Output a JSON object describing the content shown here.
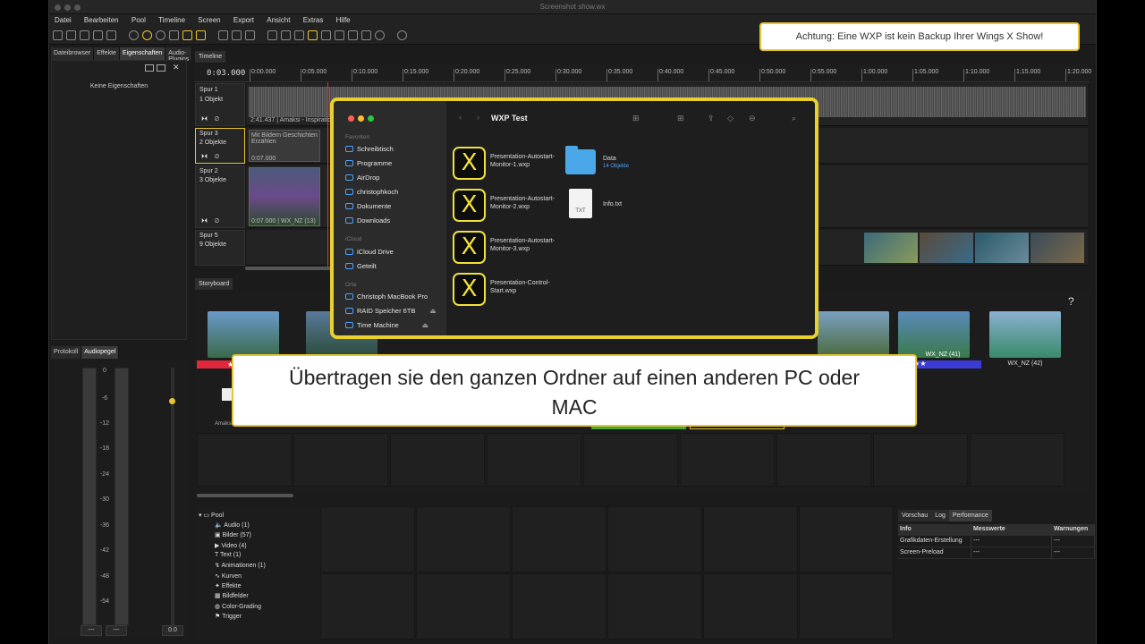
{
  "window": {
    "title": "Screenshot show.wx"
  },
  "menu": [
    "Datei",
    "Bearbeiten",
    "Pool",
    "Timeline",
    "Screen",
    "Export",
    "Ansicht",
    "Extras",
    "Hilfe"
  ],
  "notice": {
    "text": "Achtung: Eine WXP ist kein Backup Ihrer Wings X Show!"
  },
  "left_tabs": [
    "Dateibrowser",
    "Effekte",
    "Eigenschaften",
    "Audio-Plugins"
  ],
  "left_panel": {
    "empty_text": "Keine Eigenschaften"
  },
  "lower_left_tabs": [
    "Protokoll",
    "Audiopegel"
  ],
  "audio": {
    "db_labels": [
      "0",
      "-6",
      "-12",
      "-18",
      "-24",
      "-30",
      "-36",
      "-42",
      "-48",
      "-54"
    ],
    "box1": "---",
    "box2": "---",
    "box3": "0.0",
    "fader_level": 0.13
  },
  "timeline": {
    "tab": "Timeline",
    "timecode": "0:03.000",
    "ruler": [
      "0:00.000",
      "0:05.000",
      "0:10.000",
      "0:15.000",
      "0:20.000",
      "0:25.000",
      "0:30.000",
      "0:35.000",
      "0:40.000",
      "0:45.000",
      "0:50.000",
      "0:55.000",
      "1:00.000",
      "1:05.000",
      "1:10.000",
      "1:15.000",
      "1:20.000"
    ],
    "tracks": [
      {
        "name": "Spur 1",
        "count": "1 Objekt",
        "clip": "2:41.437 | Amaksi - Inspiration"
      },
      {
        "name": "Spur 3",
        "count": "2 Objekte",
        "clip_title": "Mit Bildern Geschichten Erzählen",
        "clip": "0:07.000"
      },
      {
        "name": "Spur 2",
        "count": "3 Objekte",
        "clip": "0:07.000 | WX_NZ (13)"
      },
      {
        "name": "Spur 5",
        "count": "9 Objekte",
        "clip": ""
      }
    ]
  },
  "storyboard": {
    "tab": "Storyboard",
    "help": "?",
    "thumbs": [
      {
        "label": "WX",
        "stars": "★"
      },
      {
        "label": "",
        "stars": ""
      },
      {
        "label": "",
        "stars": ""
      },
      {
        "label": "WX_NZ (41)",
        "stars": "★★★"
      },
      {
        "label": "WX_NZ (42)",
        "stars": ""
      }
    ],
    "audio_item": "Amaksi - Inspirati..."
  },
  "finder": {
    "title": "WXP Test",
    "sections": {
      "favorites": "Favoriten",
      "icloud": "iCloud",
      "locations": "Orte"
    },
    "favorites": [
      "Schreibtisch",
      "Programme",
      "AirDrop",
      "christophkoch",
      "Dokumente",
      "Downloads"
    ],
    "icloud": [
      "iCloud Drive",
      "Geteilt"
    ],
    "locations": [
      "Christoph MacBook Pro",
      "RAID Speicher 6TB",
      "Time Machine"
    ],
    "files": [
      {
        "name": "Presentation-Autostart-Monitor-1.wxp"
      },
      {
        "name": "Presentation-Autostart-Monitor-2.wxp"
      },
      {
        "name": "Presentation-Autostart-Monitor-3.wxp"
      },
      {
        "name": "Presentation-Control-Start.wxp"
      }
    ],
    "folder": {
      "name": "Data",
      "sub": "14 Objekte"
    },
    "txt": {
      "name": "Info.txt",
      "badge": "TXT"
    }
  },
  "caption": {
    "line1": "Übertragen sie den ganzen Ordner auf einen anderen PC oder",
    "line2": "MAC"
  },
  "pool": {
    "root": "Pool",
    "items": [
      "Audio (1)",
      "Bilder (57)",
      "Video (4)",
      "Text (1)",
      "Animationen (1)",
      "Kurven",
      "Effekte",
      "Bildfelder",
      "Color-Grading",
      "Trigger"
    ]
  },
  "perf": {
    "tabs": [
      "Vorschau",
      "Log",
      "Performance"
    ],
    "headers": [
      "Info",
      "Messwerte",
      "Warnungen"
    ],
    "rows": [
      [
        "Grafikdaten-Erstellung",
        "---",
        "---"
      ],
      [
        "Screen-Preload",
        "---",
        "---"
      ]
    ]
  },
  "colors": {
    "accent": "#e8c52e",
    "red_bar": "#e0283a",
    "blue_bar": "#3b3bd8",
    "green_bar": "#3faa3f",
    "folder": "#4aa8e8"
  }
}
